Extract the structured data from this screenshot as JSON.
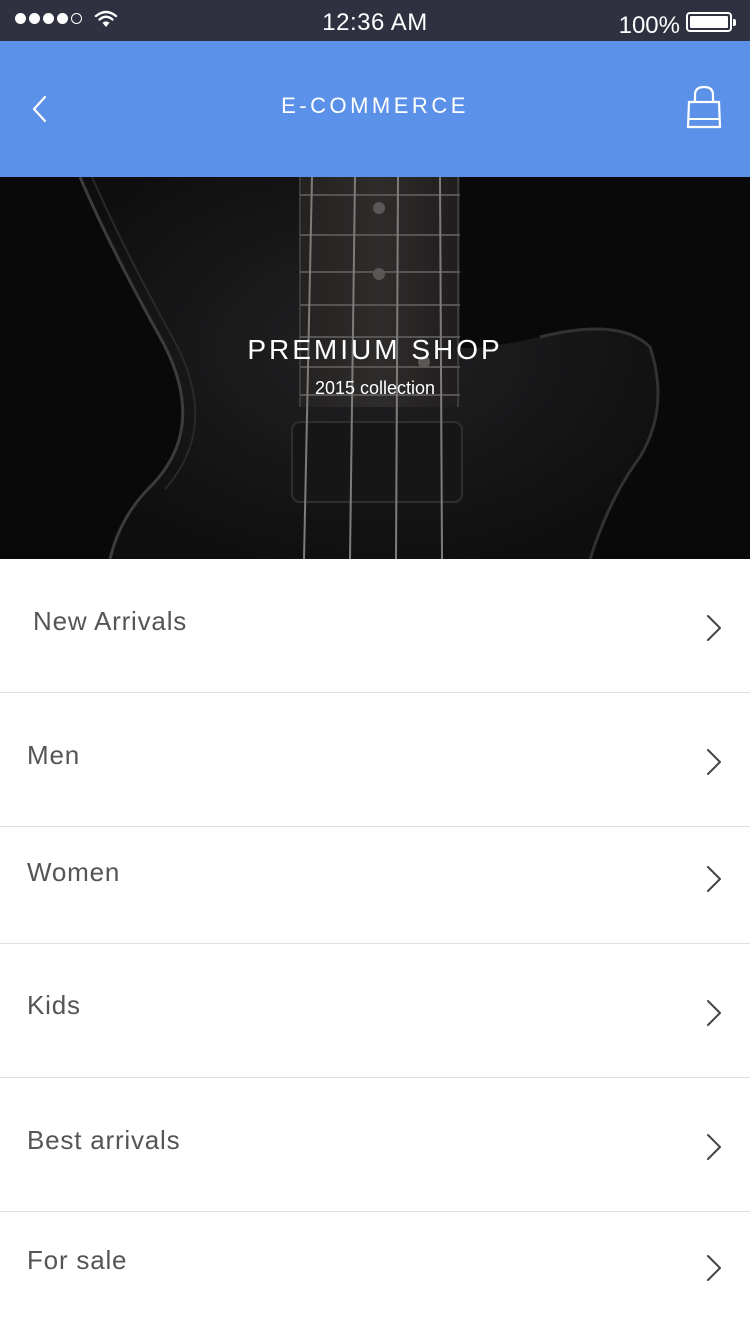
{
  "status_bar": {
    "time": "12:36 AM",
    "battery_percent": "100%",
    "signal_bars_filled": 4,
    "signal_bars_total": 5,
    "battery_level": 1.0
  },
  "nav": {
    "title": "E-COMMERCE",
    "back_icon": "chevron-left-icon",
    "cart_icon": "shopping-bag-icon",
    "background_color": "#5b91e8"
  },
  "hero": {
    "title": "PREMIUM SHOP",
    "subtitle": "2015 collection",
    "image": "bass-guitar-photo"
  },
  "menu": {
    "items": [
      {
        "label": "New Arrivals"
      },
      {
        "label": "Men"
      },
      {
        "label": "Women"
      },
      {
        "label": "Kids"
      },
      {
        "label": "Best arrivals"
      },
      {
        "label": "For sale"
      }
    ],
    "chevron_icon": "chevron-right-icon"
  },
  "colors": {
    "status_bar": "#2f3140",
    "accent": "#5b91e8",
    "text": "#555555",
    "divider": "#e0e0e0"
  }
}
